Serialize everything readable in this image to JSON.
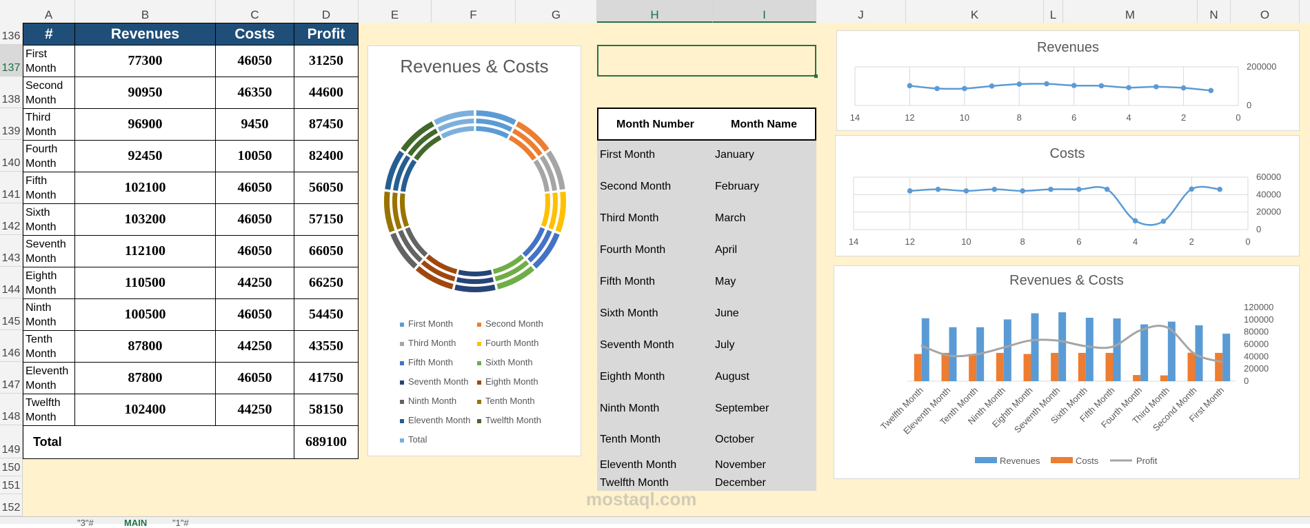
{
  "columns": [
    "A",
    "B",
    "C",
    "D",
    "E",
    "F",
    "G",
    "H",
    "I",
    "J",
    "K",
    "L",
    "M",
    "N",
    "O"
  ],
  "rows": [
    "136",
    "137",
    "138",
    "139",
    "140",
    "141",
    "142",
    "143",
    "144",
    "145",
    "146",
    "147",
    "148",
    "149",
    "150",
    "151",
    "152"
  ],
  "table": {
    "headers": [
      "#",
      "Revenues",
      "Costs",
      "Profit"
    ],
    "rows": [
      {
        "month": "First Month",
        "revenues": "77300",
        "costs": "46050",
        "profit": "31250"
      },
      {
        "month": "Second Month",
        "revenues": "90950",
        "costs": "46350",
        "profit": "44600"
      },
      {
        "month": "Third Month",
        "revenues": "96900",
        "costs": "9450",
        "profit": "87450"
      },
      {
        "month": "Fourth Month",
        "revenues": "92450",
        "costs": "10050",
        "profit": "82400"
      },
      {
        "month": "Fifth Month",
        "revenues": "102100",
        "costs": "46050",
        "profit": "56050"
      },
      {
        "month": "Sixth Month",
        "revenues": "103200",
        "costs": "46050",
        "profit": "57150"
      },
      {
        "month": "Seventh Month",
        "revenues": "112100",
        "costs": "46050",
        "profit": "66050"
      },
      {
        "month": "Eighth Month",
        "revenues": "110500",
        "costs": "44250",
        "profit": "66250"
      },
      {
        "month": "Ninth Month",
        "revenues": "100500",
        "costs": "46050",
        "profit": "54450"
      },
      {
        "month": "Tenth Month",
        "revenues": "87800",
        "costs": "44250",
        "profit": "43550"
      },
      {
        "month": "Eleventh Month",
        "revenues": "87800",
        "costs": "46050",
        "profit": "41750"
      },
      {
        "month": "Twelfth Month",
        "revenues": "102400",
        "costs": "44250",
        "profit": "58150"
      }
    ],
    "total_label": "Total",
    "total_value": "689100"
  },
  "donut": {
    "title": "Revenues & Costs",
    "legend": [
      {
        "label": "First Month",
        "color": "#5b9bd5"
      },
      {
        "label": "Second Month",
        "color": "#ed7d31"
      },
      {
        "label": "Third Month",
        "color": "#a5a5a5"
      },
      {
        "label": "Fourth Month",
        "color": "#ffc000"
      },
      {
        "label": "Fifth Month",
        "color": "#4472c4"
      },
      {
        "label": "Sixth Month",
        "color": "#70ad47"
      },
      {
        "label": "Seventh Month",
        "color": "#264478"
      },
      {
        "label": "Eighth Month",
        "color": "#9e480e"
      },
      {
        "label": "Ninth Month",
        "color": "#636363"
      },
      {
        "label": "Tenth Month",
        "color": "#997300"
      },
      {
        "label": "Eleventh Month",
        "color": "#255e91"
      },
      {
        "label": "Twelfth Month",
        "color": "#43682b"
      },
      {
        "label": "Total",
        "color": "#7cafdd"
      }
    ]
  },
  "lookup": {
    "headers": [
      "Month Number",
      "Month Name"
    ],
    "rows": [
      [
        "First Month",
        "January"
      ],
      [
        "Second Month",
        "February"
      ],
      [
        "Third Month",
        "March"
      ],
      [
        "Fourth Month",
        "April"
      ],
      [
        "Fifth Month",
        "May"
      ],
      [
        "Sixth Month",
        "June"
      ],
      [
        "Seventh Month",
        "July"
      ],
      [
        "Eighth Month",
        "August"
      ],
      [
        "Ninth Month",
        "September"
      ],
      [
        "Tenth Month",
        "October"
      ],
      [
        "Eleventh Month",
        "November"
      ],
      [
        "Twelfth Month",
        "December"
      ]
    ]
  },
  "chart_data": [
    {
      "type": "line",
      "title": "Revenues",
      "x": [
        12,
        11,
        10,
        9,
        8,
        7,
        6,
        5,
        4,
        3,
        2,
        1
      ],
      "values": [
        102400,
        87800,
        87800,
        100500,
        110500,
        112100,
        103200,
        102100,
        92450,
        96900,
        90950,
        77300
      ],
      "xlim": [
        14,
        0
      ],
      "ylim": [
        0,
        200000
      ],
      "xticks": [
        "14",
        "12",
        "10",
        "8",
        "6",
        "4",
        "2",
        "0"
      ],
      "yticks": [
        "200000",
        "0"
      ],
      "color": "#5b9bd5"
    },
    {
      "type": "line",
      "title": "Costs",
      "x": [
        12,
        11,
        10,
        9,
        8,
        7,
        6,
        5,
        4,
        3,
        2,
        1
      ],
      "values": [
        44250,
        46050,
        44250,
        46050,
        44250,
        46050,
        46050,
        46050,
        10050,
        9450,
        46350,
        46050
      ],
      "xlim": [
        14,
        0
      ],
      "ylim": [
        0,
        60000
      ],
      "xticks": [
        "14",
        "12",
        "10",
        "8",
        "6",
        "4",
        "2",
        "0"
      ],
      "yticks": [
        "60000",
        "40000",
        "20000",
        "0"
      ],
      "color": "#5b9bd5"
    },
    {
      "type": "bar",
      "title": "Revenues & Costs",
      "categories": [
        "Twelfth Month",
        "Eleventh Month",
        "Tenth Month",
        "Ninth Month",
        "Eighth Month",
        "Seventh Month",
        "Sixth Month",
        "Fifth Month",
        "Fourth Month",
        "Third Month",
        "Second Month",
        "First Month"
      ],
      "series": [
        {
          "name": "Revenues",
          "values": [
            102400,
            87800,
            87800,
            100500,
            110500,
            112100,
            103200,
            102100,
            92450,
            96900,
            90950,
            77300
          ],
          "color": "#5b9bd5"
        },
        {
          "name": "Costs",
          "values": [
            44250,
            46050,
            44250,
            46050,
            44250,
            46050,
            46050,
            46050,
            10050,
            9450,
            46350,
            46050
          ],
          "color": "#ed7d31"
        },
        {
          "name": "Profit",
          "values": [
            58150,
            41750,
            43550,
            54450,
            66250,
            66050,
            57150,
            56050,
            82400,
            87450,
            44600,
            31250
          ],
          "color": "#a5a5a5",
          "line": true
        }
      ],
      "ylim": [
        0,
        120000
      ],
      "yticks": [
        "120000",
        "100000",
        "80000",
        "60000",
        "40000",
        "20000",
        "0"
      ]
    }
  ],
  "sheet_tabs": [
    "\"3\"#",
    "MAIN",
    "\"1\"#"
  ],
  "watermark": "mostaql.com"
}
